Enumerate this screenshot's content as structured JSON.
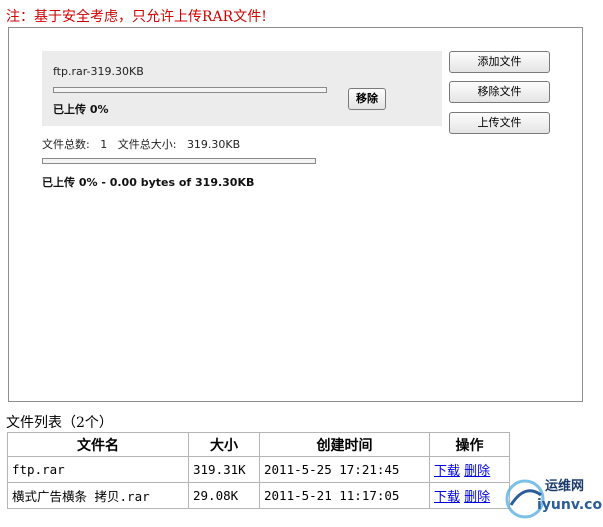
{
  "notice": "注：基于安全考虑，只允许上传RAR文件!",
  "uploader": {
    "file_card": {
      "file_name": "ftp.rar-319.30KB",
      "progress_percent": 0,
      "status": "已上传 0%",
      "remove_label": "移除"
    },
    "buttons": {
      "add": "添加文件",
      "remove": "移除文件",
      "upload": "上传文件"
    },
    "stats": {
      "count_label": "文件总数:",
      "count_value": "1",
      "size_label": "文件总大小:",
      "size_value": "319.30KB"
    },
    "overall_progress_percent": 0,
    "overall_status": "已上传 0% - 0.00 bytes of 319.30KB"
  },
  "file_list": {
    "title": "文件列表（2个）",
    "headers": [
      "文件名",
      "大小",
      "创建时间",
      "操作"
    ],
    "rows": [
      {
        "name": "ftp.rar",
        "size": "319.31K",
        "created": "2011-5-25 17:21:45",
        "download": "下载",
        "delete": "删除"
      },
      {
        "name": "横式广告横条 拷贝.rar",
        "size": "29.08K",
        "created": "2011-5-21 11:17:05",
        "download": "下载",
        "delete": "删除"
      }
    ]
  },
  "watermark": {
    "line1": "运维网",
    "line2": "iyunv.com"
  },
  "colors": {
    "notice": "#d00000",
    "link": "#0000dd",
    "card_bg": "#ececec"
  }
}
